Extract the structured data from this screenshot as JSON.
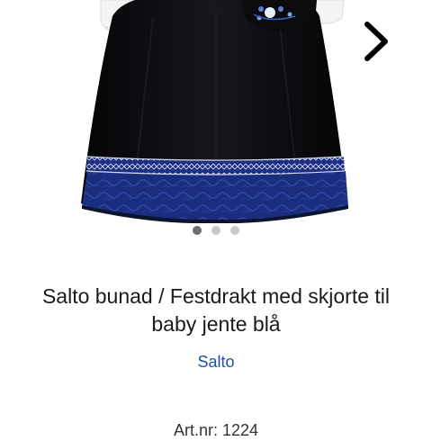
{
  "gallery": {
    "image_alt": "Salto bunad / Festdrakt med skjorte til baby jente blå",
    "dot_count": 3,
    "active_index": 0,
    "colors": {
      "skirt": "#0c0c10",
      "band": "#1b2e7e",
      "trim": "#2a3f95",
      "dot_active": "#6e6e6e",
      "dot_inactive": "#c8c8c8"
    }
  },
  "product": {
    "title_line1": "Salto bunad / Festdrakt med skjorte til",
    "title_line2": "baby jente blå",
    "brand": "Salto",
    "article": "Art.nr: 1224"
  }
}
